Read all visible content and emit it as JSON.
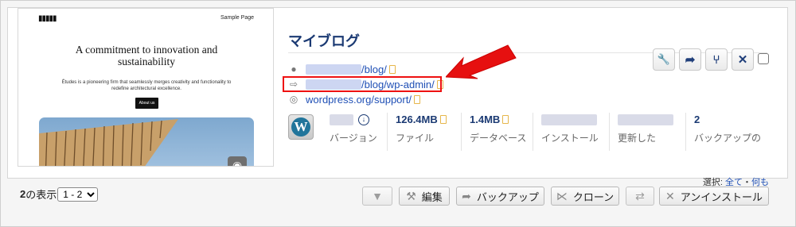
{
  "thumbnail": {
    "logo": "▮▮▮▮▮",
    "nav_link": "Sample Page",
    "hero_title": "A commitment to innovation and sustainability",
    "hero_desc": "Études is a pioneering firm that seamlessly merges creativity and functionality to redefine architectural excellence.",
    "about_button": "About us",
    "camera_icon": "camera-icon"
  },
  "site": {
    "title": "マイブログ",
    "links": [
      {
        "icon": "location-pin-icon",
        "text": "/blog/"
      },
      {
        "icon": "login-icon",
        "text": "/blog/wp-admin/"
      },
      {
        "icon": "lifebuoy-icon",
        "text": "wordpress.org/support/"
      }
    ]
  },
  "actions": [
    {
      "name": "wrench-icon",
      "glyph": "🔧"
    },
    {
      "name": "share-icon",
      "glyph": "➦"
    },
    {
      "name": "clone-icon",
      "glyph": "⑂"
    },
    {
      "name": "close-icon",
      "glyph": "✕"
    }
  ],
  "stats": {
    "version": {
      "label": "バージョン"
    },
    "files": {
      "value": "126.4MB",
      "label": "ファイル"
    },
    "database": {
      "value": "1.4MB",
      "label": "データベース"
    },
    "installed": {
      "label": "インストール"
    },
    "updated": {
      "label": "更新した"
    },
    "backups": {
      "value": "2",
      "label": "バックアップの"
    }
  },
  "selection": {
    "prefix": "選択:",
    "all": "全て",
    "separator": "・",
    "none": "何も"
  },
  "pager": {
    "count": "2",
    "label": "の表示",
    "range_option": "1 - 2"
  },
  "bottom_buttons": {
    "edit": "編集",
    "backup": "バックアップ",
    "clone": "クローン",
    "uninstall": "アンインストール"
  },
  "colors": {
    "accent": "#1b3a73",
    "link": "#1f4fb5",
    "highlight": "#e11111"
  }
}
